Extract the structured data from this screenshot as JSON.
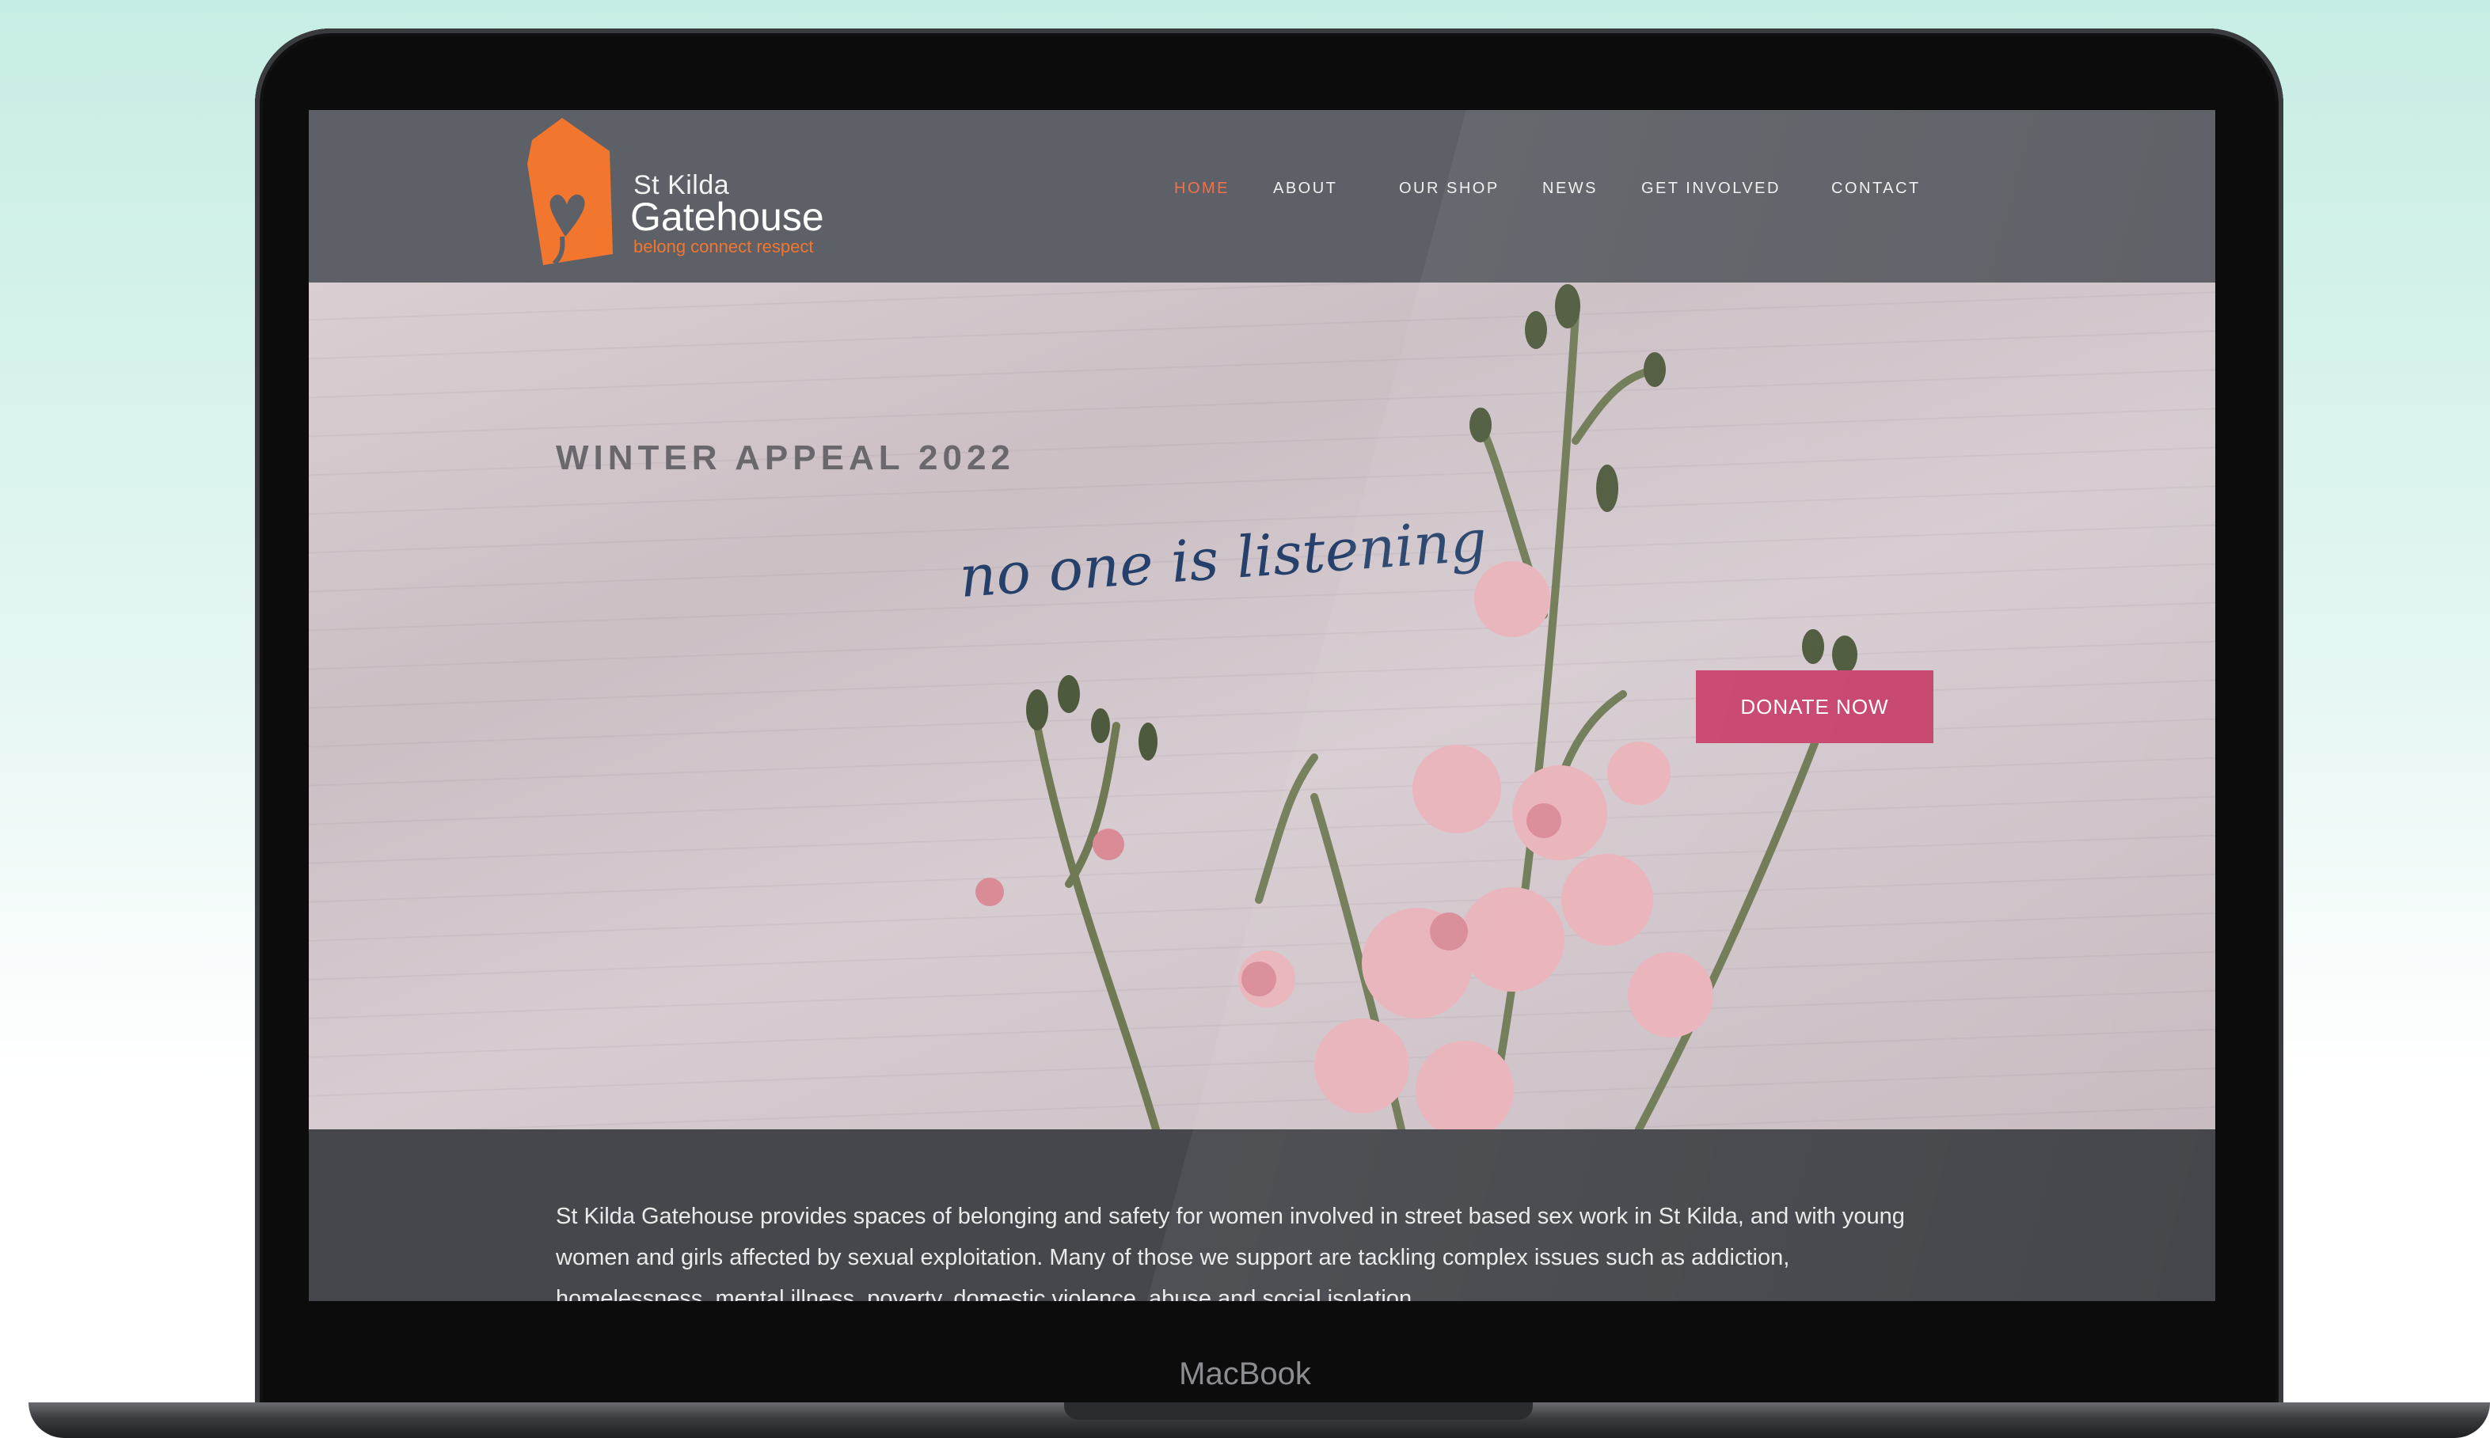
{
  "site": {
    "brand": {
      "line1": "St Kilda",
      "line2": "Gatehouse",
      "tagline": "belong connect respect",
      "color": "#f3762f"
    },
    "nav": [
      {
        "label": "HOME",
        "active": true
      },
      {
        "label": "ABOUT",
        "active": false
      },
      {
        "label": "OUR SHOP",
        "active": false
      },
      {
        "label": "NEWS",
        "active": false
      },
      {
        "label": "GET INVOLVED",
        "active": false
      },
      {
        "label": "CONTACT",
        "active": false
      }
    ],
    "hero": {
      "title": "WINTER APPEAL 2022",
      "script": "no one is listening",
      "cta_label": "DONATE NOW",
      "cta_color": "#c8466e"
    },
    "intro": {
      "text": "St Kilda Gatehouse provides spaces of belonging and safety for women involved in street based sex work in St Kilda, and with young women and girls affected by sexual exploitation. Many of those we support are tackling complex issues such as addiction, homelessness, mental illness, poverty, domestic violence, abuse and social isolation."
    }
  },
  "device": {
    "label": "MacBook"
  }
}
